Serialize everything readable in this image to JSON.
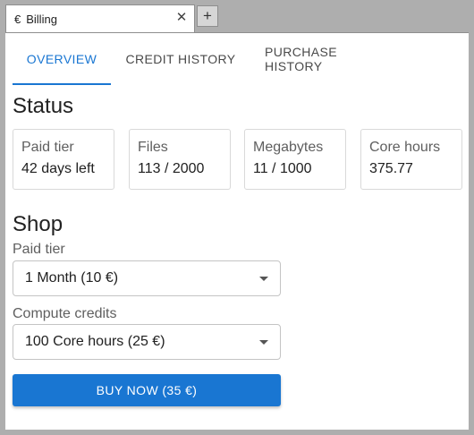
{
  "window": {
    "tab_icon": "€",
    "tab_title": "Billing",
    "close_glyph": "✕",
    "new_tab_glyph": "+"
  },
  "nav": {
    "tabs": [
      {
        "label": "OVERVIEW",
        "active": true
      },
      {
        "label": "CREDIT HISTORY",
        "active": false
      },
      {
        "label": "PURCHASE HISTORY",
        "active": false
      }
    ]
  },
  "status": {
    "heading": "Status",
    "cards": [
      {
        "title": "Paid tier",
        "value": "42 days left"
      },
      {
        "title": "Files",
        "value": "113 / 2000"
      },
      {
        "title": "Megabytes",
        "value": "11 / 1000"
      },
      {
        "title": "Core hours",
        "value": "375.77"
      }
    ]
  },
  "shop": {
    "heading": "Shop",
    "paid_tier_label": "Paid tier",
    "paid_tier_value": "1 Month (10 €)",
    "compute_label": "Compute credits",
    "compute_value": "100 Core hours (25 €)",
    "buy_label": "BUY NOW (35 €)"
  },
  "colors": {
    "accent": "#1976d2",
    "window_bg": "#aeaeae"
  }
}
